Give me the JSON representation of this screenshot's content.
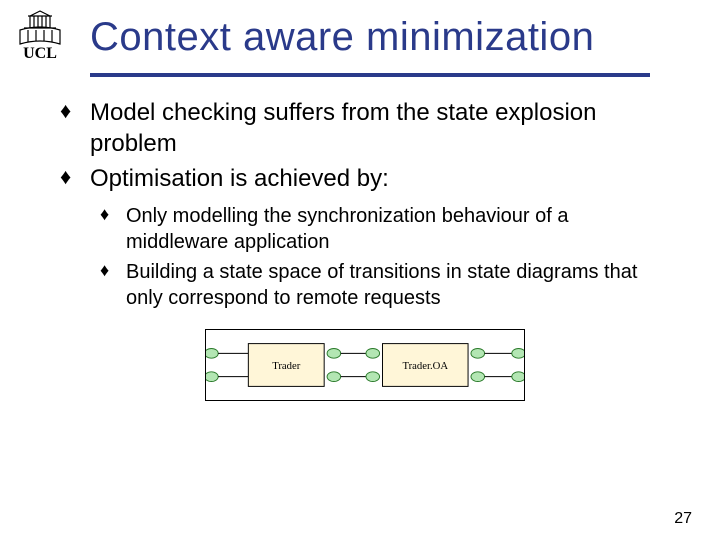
{
  "title": "Context aware minimization",
  "bullets": [
    "Model checking suffers from the state explosion problem",
    "Optimisation is achieved by:"
  ],
  "sub_bullets": [
    "Only modelling the synchronization behaviour of a middleware application",
    "Building a state space of transitions in state diagrams that only correspond to remote requests"
  ],
  "diagram": {
    "box1": "Trader",
    "box2": "Trader.OA"
  },
  "page_number": "27"
}
